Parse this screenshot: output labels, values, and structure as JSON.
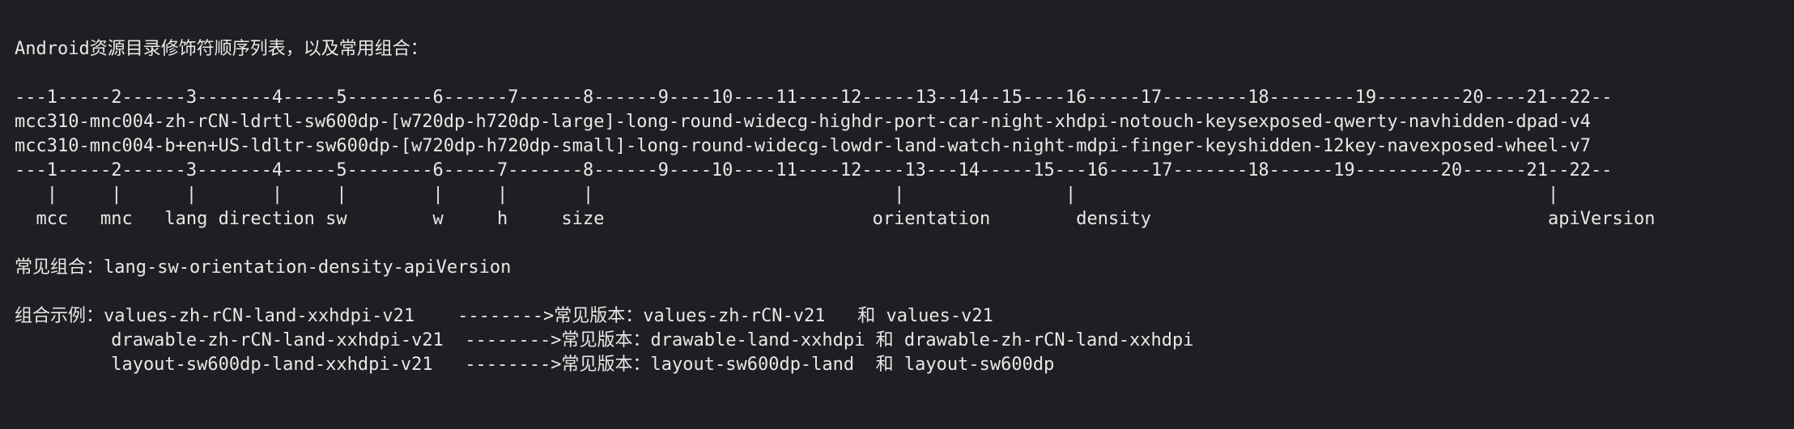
{
  "document": {
    "title_line": "Android资源目录修饰符顺序列表，以及常用组合：",
    "ruler_top": "---1-----2------3-------4-----5--------6------7------8------9----10----11----12-----13--14--15----16-----17--------18--------19--------20----21--22--",
    "example_line_1": "mcc310-mnc004-zh-rCN-ldrtl-sw600dp-[w720dp-h720dp-large]-long-round-widecg-highdr-port-car-night-xhdpi-notouch-keysexposed-qwerty-navhidden-dpad-v4",
    "example_line_2": "mcc310-mnc004-b+en+US-ldltr-sw600dp-[w720dp-h720dp-small]-long-round-widecg-lowdr-land-watch-night-mdpi-finger-keyshidden-12key-navexposed-wheel-v7",
    "ruler_bottom": "---1-----2------3-------4-----5--------6-----7-------8------9----10----11----12----13---14-----15---16----17-------18------19--------20------21--22--",
    "pipe_line": "   |     |      |       |     |        |     |       |                            |               |                                            |",
    "label_line": "  mcc   mnc   lang direction sw        w     h     size                         orientation        density                                     apiVersion",
    "common_combo": "常见组合：lang-sw-orientation-density-apiVersion",
    "combo_example_1": "组合示例：values-zh-rCN-land-xxhdpi-v21    -------->常见版本：values-zh-rCN-v21   和 values-v21",
    "combo_example_2": "         drawable-zh-rCN-land-xxhdpi-v21  -------->常见版本：drawable-land-xxhdpi 和 drawable-zh-rCN-land-xxhdpi",
    "combo_example_3": "         layout-sw600dp-land-xxhdpi-v21   -------->常见版本：layout-sw600dp-land  和 layout-sw600dp"
  }
}
